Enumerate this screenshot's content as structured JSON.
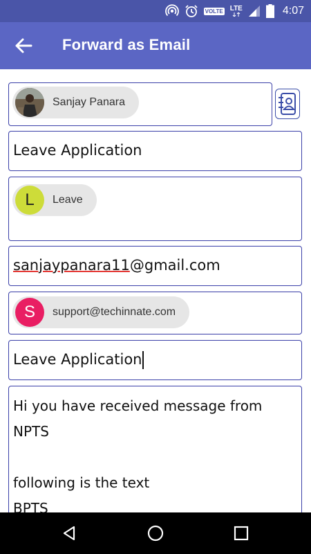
{
  "status_bar": {
    "time": "4:07",
    "volte": "VOLTE",
    "network": "LTE",
    "icons": [
      "hotspot-icon",
      "alarm-icon",
      "signal-icon",
      "battery-icon"
    ]
  },
  "app_bar": {
    "title": "Forward as Email",
    "back_icon": "back-arrow-icon"
  },
  "to_field": {
    "chip_name": "Sanjay Panara",
    "contacts_icon": "contacts-book-icon"
  },
  "subject_field": {
    "value": "Leave Application"
  },
  "label_field": {
    "chip_initial": "L",
    "chip_text": "Leave",
    "chip_color": "#cddc39"
  },
  "email_field": {
    "value_underlined": "sanjaypanara11",
    "value_rest": "@gmail.com"
  },
  "support_field": {
    "chip_initial": "S",
    "chip_text": "support@techinnate.com",
    "chip_color": "#e91e63"
  },
  "subject2_field": {
    "value": "Leave Application"
  },
  "message_field": {
    "lines": [
      "Hi you have received message from",
      "NPTS",
      "",
      "following is the text",
      "BPTS"
    ]
  },
  "nav_bar": {
    "icons": [
      "back-triangle-icon",
      "home-circle-icon",
      "recents-square-icon"
    ]
  },
  "colors": {
    "status_bar": "#4a55a8",
    "app_bar": "#5b66c4",
    "field_border": "#3a3fa8",
    "chip_bg": "#e6e6e6"
  }
}
